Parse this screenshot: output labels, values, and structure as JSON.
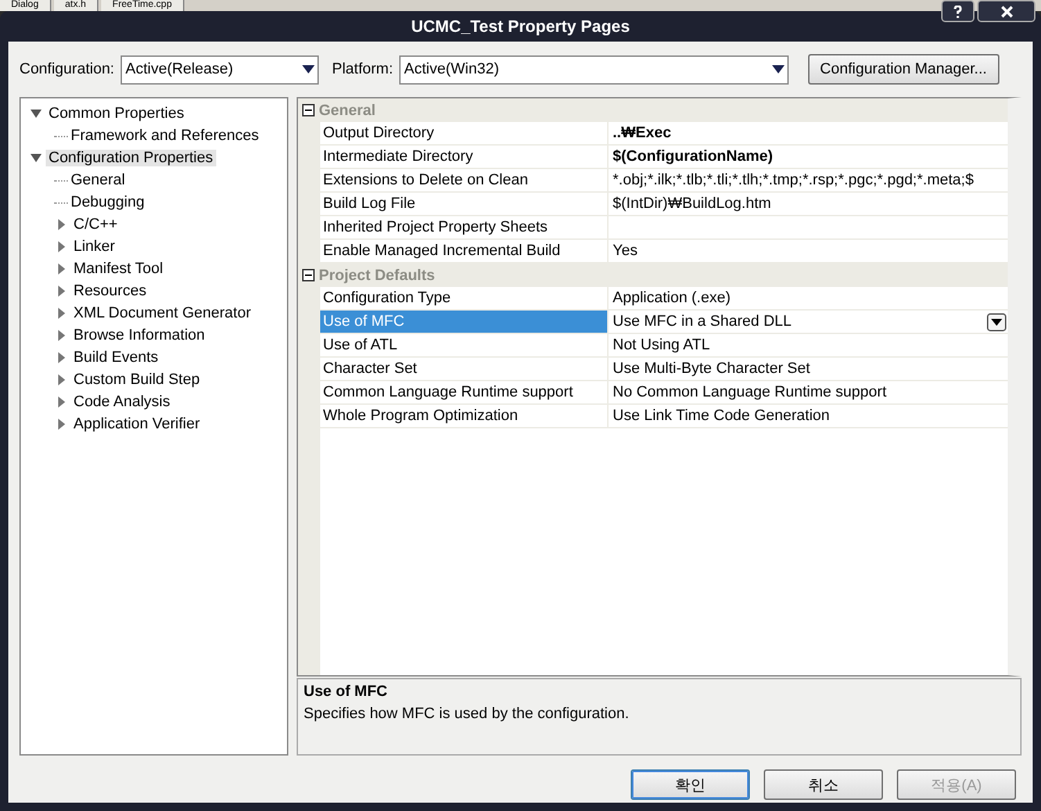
{
  "background_tabs": [
    "Dialog",
    "atx.h",
    "FreeTime.cpp"
  ],
  "window": {
    "title": "UCMC_Test Property Pages"
  },
  "configuration": {
    "label": "Configuration:",
    "value": "Active(Release)"
  },
  "platform": {
    "label": "Platform:",
    "value": "Active(Win32)"
  },
  "configuration_manager_button": "Configuration Manager...",
  "tree": [
    {
      "label": "Common Properties",
      "kind": "folder",
      "expanded": true,
      "selected": false,
      "children": [
        {
          "label": "Framework and References",
          "kind": "leaf",
          "selected": false
        }
      ]
    },
    {
      "label": "Configuration Properties",
      "kind": "folder",
      "expanded": true,
      "selected": true,
      "children": [
        {
          "label": "General",
          "kind": "leaf",
          "selected": false
        },
        {
          "label": "Debugging",
          "kind": "leaf",
          "selected": false
        },
        {
          "label": "C/C++",
          "kind": "folder",
          "expanded": false,
          "selected": false
        },
        {
          "label": "Linker",
          "kind": "folder",
          "expanded": false,
          "selected": false
        },
        {
          "label": "Manifest Tool",
          "kind": "folder",
          "expanded": false,
          "selected": false
        },
        {
          "label": "Resources",
          "kind": "folder",
          "expanded": false,
          "selected": false
        },
        {
          "label": "XML Document Generator",
          "kind": "folder",
          "expanded": false,
          "selected": false
        },
        {
          "label": "Browse Information",
          "kind": "folder",
          "expanded": false,
          "selected": false
        },
        {
          "label": "Build Events",
          "kind": "folder",
          "expanded": false,
          "selected": false
        },
        {
          "label": "Custom Build Step",
          "kind": "folder",
          "expanded": false,
          "selected": false
        },
        {
          "label": "Code Analysis",
          "kind": "folder",
          "expanded": false,
          "selected": false
        },
        {
          "label": "Application Verifier",
          "kind": "folder",
          "expanded": false,
          "selected": false
        }
      ]
    }
  ],
  "property_grid": [
    {
      "category": "General",
      "expanded": true,
      "rows": [
        {
          "name": "Output Directory",
          "value": "..₩Exec",
          "bold": true,
          "selected": false
        },
        {
          "name": "Intermediate Directory",
          "value": "$(ConfigurationName)",
          "bold": true,
          "selected": false
        },
        {
          "name": "Extensions to Delete on Clean",
          "value": "*.obj;*.ilk;*.tlb;*.tli;*.tlh;*.tmp;*.rsp;*.pgc;*.pgd;*.meta;$",
          "selected": false
        },
        {
          "name": "Build Log File",
          "value": "$(IntDir)₩BuildLog.htm",
          "selected": false
        },
        {
          "name": "Inherited Project Property Sheets",
          "selected": false
        },
        {
          "name": "Enable Managed Incremental Build",
          "value": "Yes",
          "selected": false
        }
      ]
    },
    {
      "category": "Project Defaults",
      "expanded": true,
      "rows": [
        {
          "name": "Configuration Type",
          "value": "Application (.exe)",
          "selected": false
        },
        {
          "name": "Use of MFC",
          "value": "Use MFC in a Shared DLL",
          "selected": true
        },
        {
          "name": "Use of ATL",
          "value": "Not Using ATL",
          "selected": false
        },
        {
          "name": "Character Set",
          "value": "Use Multi-Byte Character Set",
          "selected": false
        },
        {
          "name": "Common Language Runtime support",
          "value": "No Common Language Runtime support",
          "selected": false
        },
        {
          "name": "Whole Program Optimization",
          "value": "Use Link Time Code Generation",
          "selected": false
        }
      ]
    }
  ],
  "description": {
    "title": "Use of MFC",
    "text": "Specifies how MFC is used by the configuration."
  },
  "buttons": [
    {
      "label": "확인",
      "default": true,
      "disabled": false
    },
    {
      "label": "취소",
      "default": false,
      "disabled": false
    },
    {
      "label": "적용(A)",
      "default": false,
      "disabled": true
    }
  ]
}
